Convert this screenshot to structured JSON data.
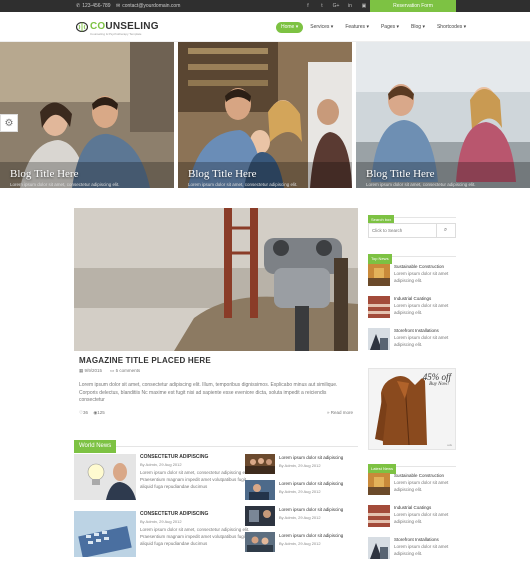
{
  "topbar": {
    "phone": "123-456-789",
    "email": "contact@yourdomain.com",
    "socials": [
      "f",
      "t",
      "G+",
      "in",
      "▣",
      "◎"
    ],
    "reserve": "Reservation Form"
  },
  "header": {
    "logo_prefix": "CO",
    "logo_main": "UNSELING",
    "tagline": "Counseling & Psychotherapy Template"
  },
  "nav": [
    "Home ▾",
    "Services ▾",
    "Features ▾",
    "Pages ▾",
    "Blog ▾",
    "Shortcodes ▾"
  ],
  "hero": [
    {
      "caption": "Blog Title Here",
      "sub": "Lorem ipsum dolor sit amet, consectetur adipiscing elit."
    },
    {
      "caption": "Blog Title Here",
      "sub": "Lorem ipsum dolor sit amet, consectetur adipiscing elit."
    },
    {
      "caption": "Blog Title Here",
      "sub": "Lorem ipsum dolor sit amet, consectetur adipiscing elit."
    }
  ],
  "post": {
    "title": "MAGAZINE TITLE PLACED HERE",
    "date": "9/9/2015",
    "comments": "5 comments",
    "excerpt": "Lorem ipsum dolor sit amet, consectetur adipiscing elit. Illum, temporibus dignissimos. Explicabo minus aut similique. Corporis delectus, blanditiis Nc maxime est fugit nisi ad sapiente esse eveniore dicta, soluta impedit a reiciendis consectetur",
    "likes": "36",
    "views": "125",
    "more": "» Read more"
  },
  "world": {
    "heading": "World News",
    "big": [
      {
        "title": "CONSECTETUR ADIPISCING",
        "meta": "By Admin, 29 Aug 2012",
        "excerpt": "Lorem ipsum dolor sit amet, consectetur adipiscing elit. Praesentium magnam impedit amet volutpatibus fugit aliquid fuga repudiandae ducimus"
      },
      {
        "title": "CONSECTETUR ADIPISCING",
        "meta": "By Admin, 29 Aug 2012",
        "excerpt": "Lorem ipsum dolor sit amet, consectetur adipiscing elit. Praesentium magnam impedit amet volutpatibus fugit aliquid fuga repudiandae ducimus"
      }
    ],
    "small": [
      {
        "title": "Lorem ipsum dolor sit adipiscing",
        "meta": "By Admin, 29 Aug 2012"
      },
      {
        "title": "Lorem ipsum dolor sit adipiscing",
        "meta": "By Admin, 29 Aug 2012"
      },
      {
        "title": "Lorem ipsum dolor sit adipiscing",
        "meta": "By Admin, 29 Aug 2012"
      },
      {
        "title": "Lorem ipsum dolor sit adipiscing",
        "meta": "By Admin, 29 Aug 2012"
      }
    ]
  },
  "sidebar": {
    "search_head": "Search box",
    "search_placeholder": "Click to Search",
    "top_head": "Top News",
    "top": [
      {
        "title": "Sustainable Construction",
        "excerpt": "Lorem ipsum dolor sit amet adipiscing elit."
      },
      {
        "title": "Industrial Coatings",
        "excerpt": "Lorem ipsum dolor sit amet adipiscing elit."
      },
      {
        "title": "Storefront Installations",
        "excerpt": "Lorem ipsum dolor sit amet adipiscing elit."
      }
    ],
    "ad": {
      "off": "45% off",
      "buy": "Buy Now!",
      "tiny": "ads"
    },
    "latest_head": "Latest News",
    "latest": [
      {
        "title": "Sustainable Construction",
        "excerpt": "Lorem ipsum dolor sit amet adipiscing elit."
      },
      {
        "title": "Industrial Coatings",
        "excerpt": "Lorem ipsum dolor sit amet adipiscing elit."
      },
      {
        "title": "Storefront Installations",
        "excerpt": "Lorem ipsum dolor sit amet adipiscing elit."
      }
    ]
  },
  "colors": {
    "accent": "#7dc243",
    "topbar": "#2f2f2f"
  }
}
